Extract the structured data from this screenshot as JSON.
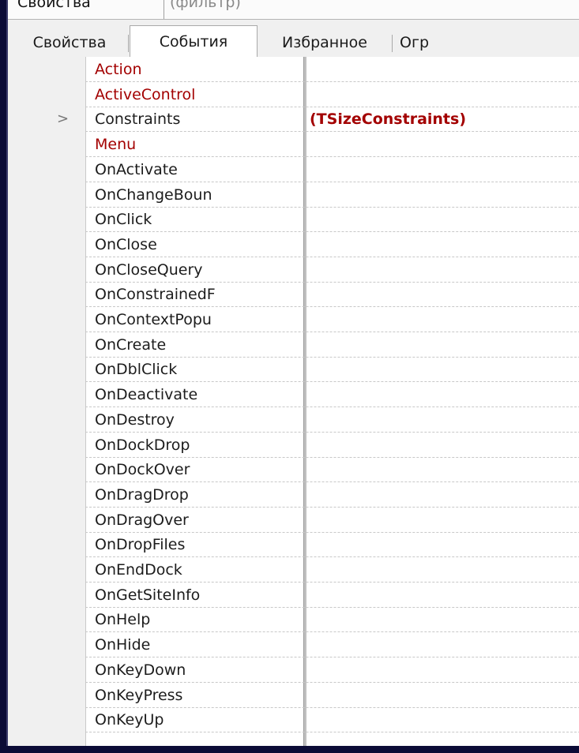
{
  "filter": {
    "label": "Свойства",
    "placeholder": "(фильтр)"
  },
  "tabs": [
    {
      "label": "Свойства",
      "active": false
    },
    {
      "label": "События",
      "active": true
    },
    {
      "label": "Избранное",
      "active": false
    },
    {
      "label": "Огр",
      "active": false
    }
  ],
  "rows": [
    {
      "name": "Action",
      "value": "",
      "highlight": true,
      "expand": ""
    },
    {
      "name": "ActiveControl",
      "value": "",
      "highlight": true,
      "expand": ""
    },
    {
      "name": "Constraints",
      "value": "(TSizeConstraints)",
      "highlight": false,
      "expand": ">"
    },
    {
      "name": "Menu",
      "value": "",
      "highlight": true,
      "expand": ""
    },
    {
      "name": "OnActivate",
      "value": "",
      "highlight": false,
      "expand": ""
    },
    {
      "name": "OnChangeBoun",
      "value": "",
      "highlight": false,
      "expand": ""
    },
    {
      "name": "OnClick",
      "value": "",
      "highlight": false,
      "expand": ""
    },
    {
      "name": "OnClose",
      "value": "",
      "highlight": false,
      "expand": ""
    },
    {
      "name": "OnCloseQuery",
      "value": "",
      "highlight": false,
      "expand": ""
    },
    {
      "name": "OnConstrainedF",
      "value": "",
      "highlight": false,
      "expand": ""
    },
    {
      "name": "OnContextPopu",
      "value": "",
      "highlight": false,
      "expand": ""
    },
    {
      "name": "OnCreate",
      "value": "",
      "highlight": false,
      "expand": ""
    },
    {
      "name": "OnDblClick",
      "value": "",
      "highlight": false,
      "expand": ""
    },
    {
      "name": "OnDeactivate",
      "value": "",
      "highlight": false,
      "expand": ""
    },
    {
      "name": "OnDestroy",
      "value": "",
      "highlight": false,
      "expand": ""
    },
    {
      "name": "OnDockDrop",
      "value": "",
      "highlight": false,
      "expand": ""
    },
    {
      "name": "OnDockOver",
      "value": "",
      "highlight": false,
      "expand": ""
    },
    {
      "name": "OnDragDrop",
      "value": "",
      "highlight": false,
      "expand": ""
    },
    {
      "name": "OnDragOver",
      "value": "",
      "highlight": false,
      "expand": ""
    },
    {
      "name": "OnDropFiles",
      "value": "",
      "highlight": false,
      "expand": ""
    },
    {
      "name": "OnEndDock",
      "value": "",
      "highlight": false,
      "expand": ""
    },
    {
      "name": "OnGetSiteInfo",
      "value": "",
      "highlight": false,
      "expand": ""
    },
    {
      "name": "OnHelp",
      "value": "",
      "highlight": false,
      "expand": ""
    },
    {
      "name": "OnHide",
      "value": "",
      "highlight": false,
      "expand": ""
    },
    {
      "name": "OnKeyDown",
      "value": "",
      "highlight": false,
      "expand": ""
    },
    {
      "name": "OnKeyPress",
      "value": "",
      "highlight": false,
      "expand": ""
    },
    {
      "name": "OnKeyUp",
      "value": "",
      "highlight": false,
      "expand": ""
    }
  ],
  "colors": {
    "highlight": "#a30000",
    "text": "#1c1c1c",
    "frame": "#0b0b36"
  }
}
